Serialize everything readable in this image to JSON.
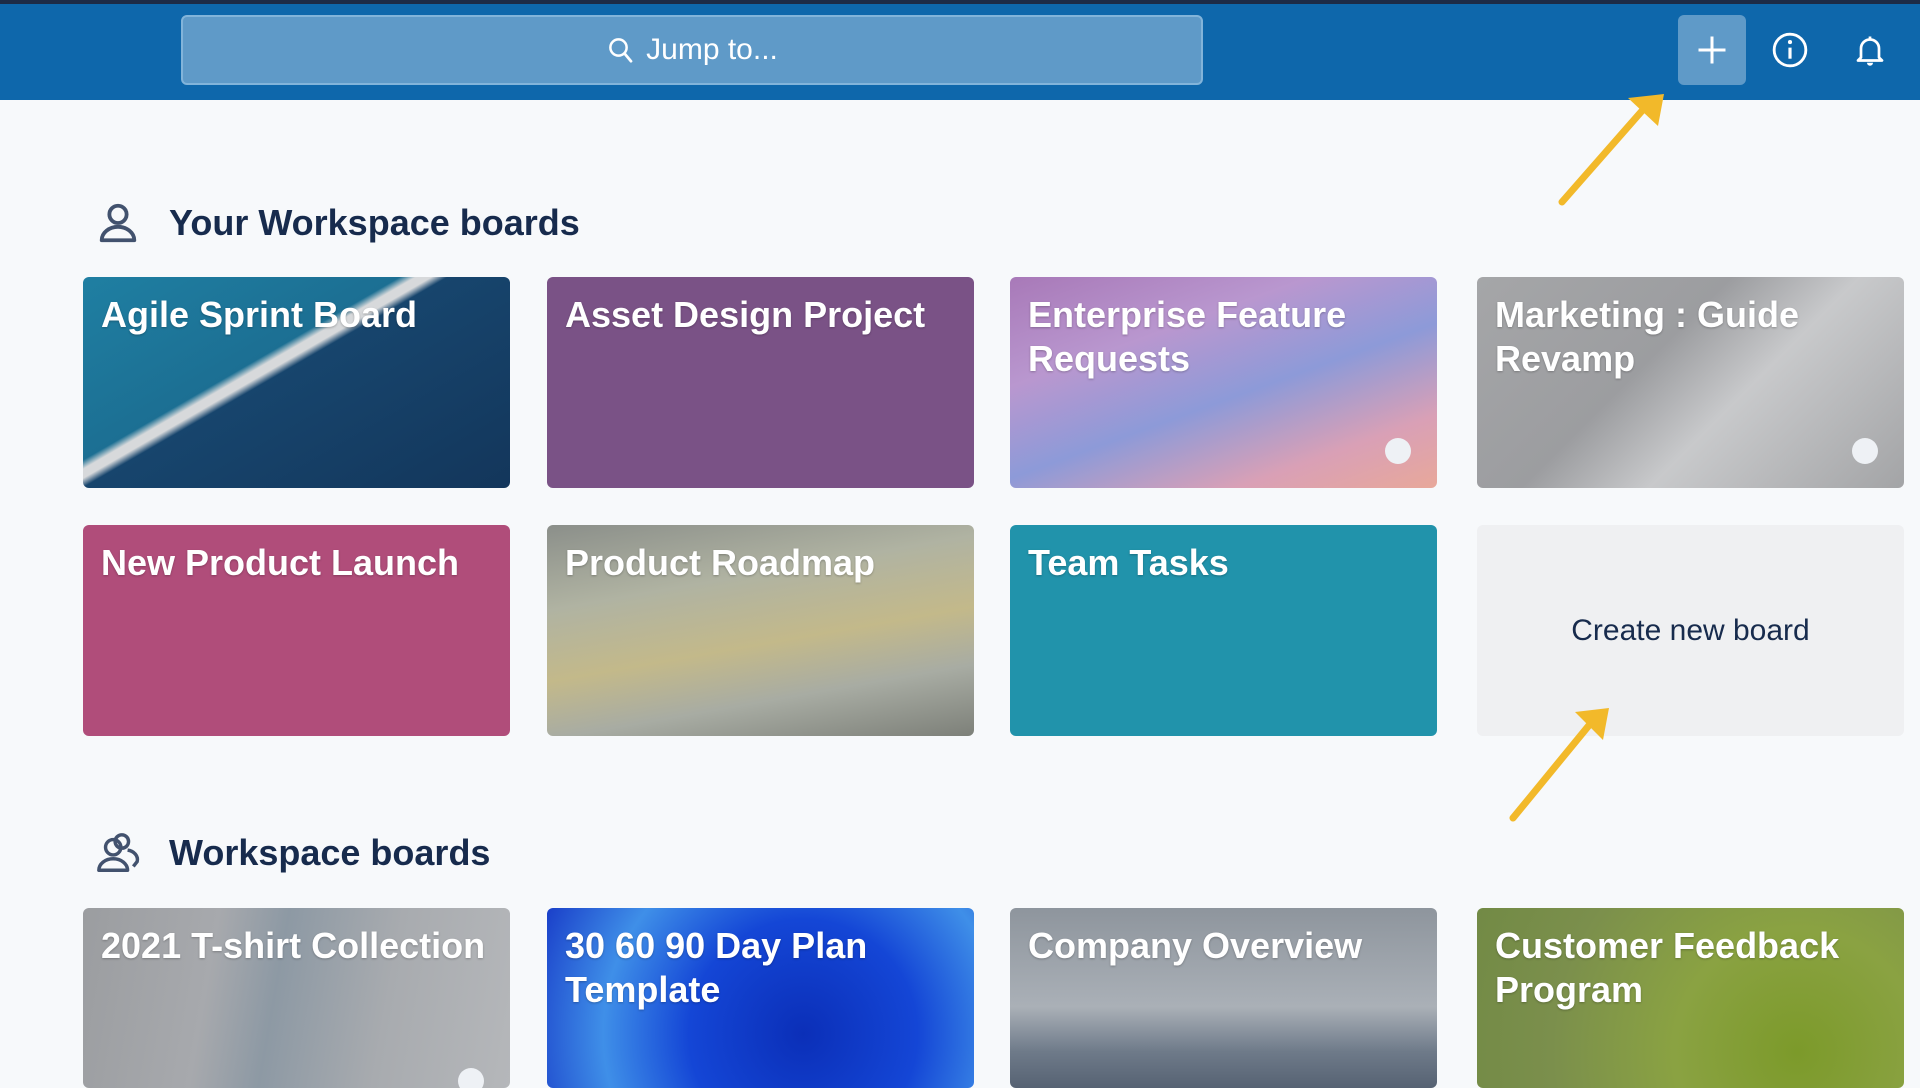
{
  "header": {
    "search_placeholder": "Jump to...",
    "icons": [
      "search-icon",
      "plus-icon",
      "info-icon",
      "bell-icon"
    ]
  },
  "colors": {
    "header_bg": "#0e67ab",
    "search_bg": "#5f9ac8",
    "heading_text": "#172b4d",
    "annotation_arrow": "#f2b92a"
  },
  "your_boards": {
    "title": "Your Workspace boards",
    "icon": "person-icon",
    "boards": [
      {
        "title": "Agile Sprint Board",
        "background": "running-track-photo"
      },
      {
        "title": "Asset Design Project",
        "background": "#7a5286"
      },
      {
        "title": "Enterprise Feature Requests",
        "background": "sunset-sky-photo"
      },
      {
        "title": "Marketing : Guide Revamp",
        "background": "open-book-photo"
      },
      {
        "title": "New Product Launch",
        "background": "#b04d7a"
      },
      {
        "title": "Product Roadmap",
        "background": "map-photo"
      },
      {
        "title": "Team Tasks",
        "background": "#2193ab"
      }
    ],
    "create_label": "Create new board"
  },
  "workspace_boards": {
    "title": "Workspace boards",
    "icon": "people-icon",
    "boards": [
      {
        "title": "2021 T-shirt Collection",
        "background": "tshirt-photo"
      },
      {
        "title": "30 60 90 Day Plan Template",
        "background": "blue-swirl-photo"
      },
      {
        "title": "Company Overview",
        "background": "ski-lift-photo"
      },
      {
        "title": "Customer Feedback Program",
        "background": "lime-photo"
      }
    ]
  }
}
